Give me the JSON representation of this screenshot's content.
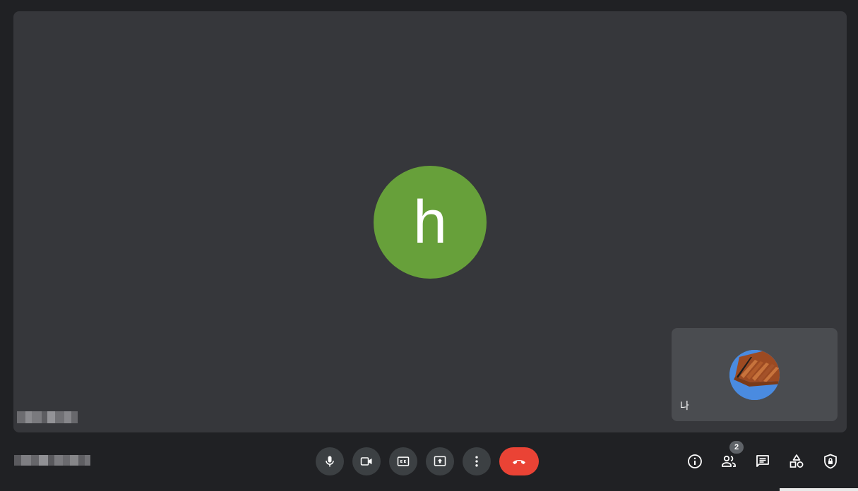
{
  "main_tile": {
    "avatar_initial": "h",
    "avatar_color": "#67a03a"
  },
  "self_tile": {
    "name": "나",
    "avatar_color": "#4a8be0"
  },
  "controls": {
    "end_call_color": "#ea4335",
    "button_color": "#3c4043"
  },
  "right_controls": {
    "participant_count": "2"
  },
  "colors": {
    "background": "#202124",
    "stage": "#36373b",
    "self_tile": "#4a4c50"
  }
}
